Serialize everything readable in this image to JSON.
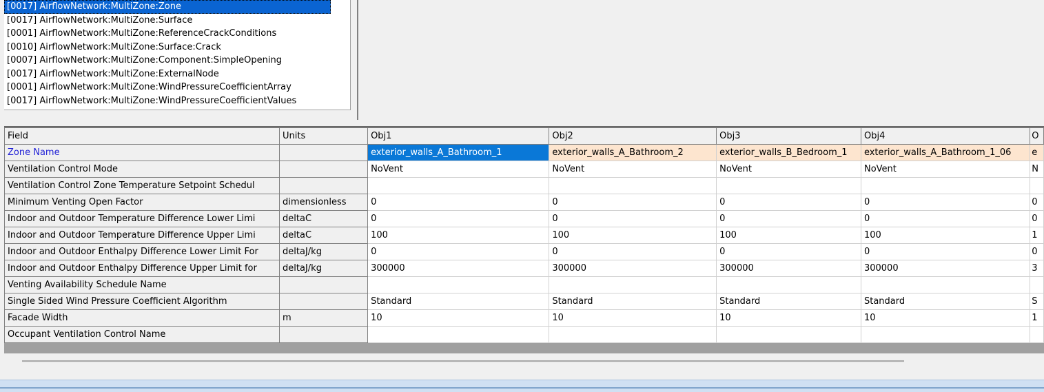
{
  "object_list": {
    "items": [
      "[0017] AirflowNetwork:MultiZone:Zone",
      "[0017] AirflowNetwork:MultiZone:Surface",
      "[0001] AirflowNetwork:MultiZone:ReferenceCrackConditions",
      "[0010] AirflowNetwork:MultiZone:Surface:Crack",
      "[0007] AirflowNetwork:MultiZone:Component:SimpleOpening",
      "[0017] AirflowNetwork:MultiZone:ExternalNode",
      "[0001] AirflowNetwork:MultiZone:WindPressureCoefficientArray",
      "[0017] AirflowNetwork:MultiZone:WindPressureCoefficientValues"
    ],
    "selected_index": 0
  },
  "grid": {
    "headers": [
      "Field",
      "Units",
      "Obj1",
      "Obj2",
      "Obj3",
      "Obj4",
      "O"
    ],
    "rows": [
      {
        "field": "Zone Name",
        "units": "",
        "values": [
          "exterior_walls_A_Bathroom_1",
          "exterior_walls_A_Bathroom_2",
          "exterior_walls_B_Bedroom_1",
          "exterior_walls_A_Bathroom_1_06",
          "e"
        ]
      },
      {
        "field": "Ventilation Control Mode",
        "units": "",
        "values": [
          "NoVent",
          "NoVent",
          "NoVent",
          "NoVent",
          "N"
        ]
      },
      {
        "field": "Ventilation Control Zone Temperature Setpoint Schedul",
        "units": "",
        "values": [
          "",
          "",
          "",
          "",
          ""
        ]
      },
      {
        "field": "Minimum Venting Open Factor",
        "units": "dimensionless",
        "values": [
          "0",
          "0",
          "0",
          "0",
          "0"
        ]
      },
      {
        "field": "Indoor and Outdoor Temperature Difference Lower Limi",
        "units": "deltaC",
        "values": [
          "0",
          "0",
          "0",
          "0",
          "0"
        ]
      },
      {
        "field": "Indoor and Outdoor Temperature Difference Upper Limi",
        "units": "deltaC",
        "values": [
          "100",
          "100",
          "100",
          "100",
          "1"
        ]
      },
      {
        "field": "Indoor and Outdoor Enthalpy Difference Lower Limit For",
        "units": "deltaJ/kg",
        "values": [
          "0",
          "0",
          "0",
          "0",
          "0"
        ]
      },
      {
        "field": "Indoor and Outdoor Enthalpy Difference Upper Limit for",
        "units": "deltaJ/kg",
        "values": [
          "300000",
          "300000",
          "300000",
          "300000",
          "3"
        ]
      },
      {
        "field": "Venting Availability Schedule Name",
        "units": "",
        "values": [
          "",
          "",
          "",
          "",
          ""
        ]
      },
      {
        "field": "Single Sided Wind Pressure Coefficient Algorithm",
        "units": "",
        "values": [
          "Standard",
          "Standard",
          "Standard",
          "Standard",
          "S"
        ]
      },
      {
        "field": "Facade Width",
        "units": "m",
        "values": [
          "10",
          "10",
          "10",
          "10",
          "1"
        ]
      },
      {
        "field": "Occupant Ventilation Control Name",
        "units": "",
        "values": [
          "",
          "",
          "",
          "",
          ""
        ]
      }
    ]
  },
  "colors": {
    "selection": "#0a64d2",
    "zone_row_highlight": "#fde5cf",
    "field_highlight": "#1f1fd6"
  }
}
